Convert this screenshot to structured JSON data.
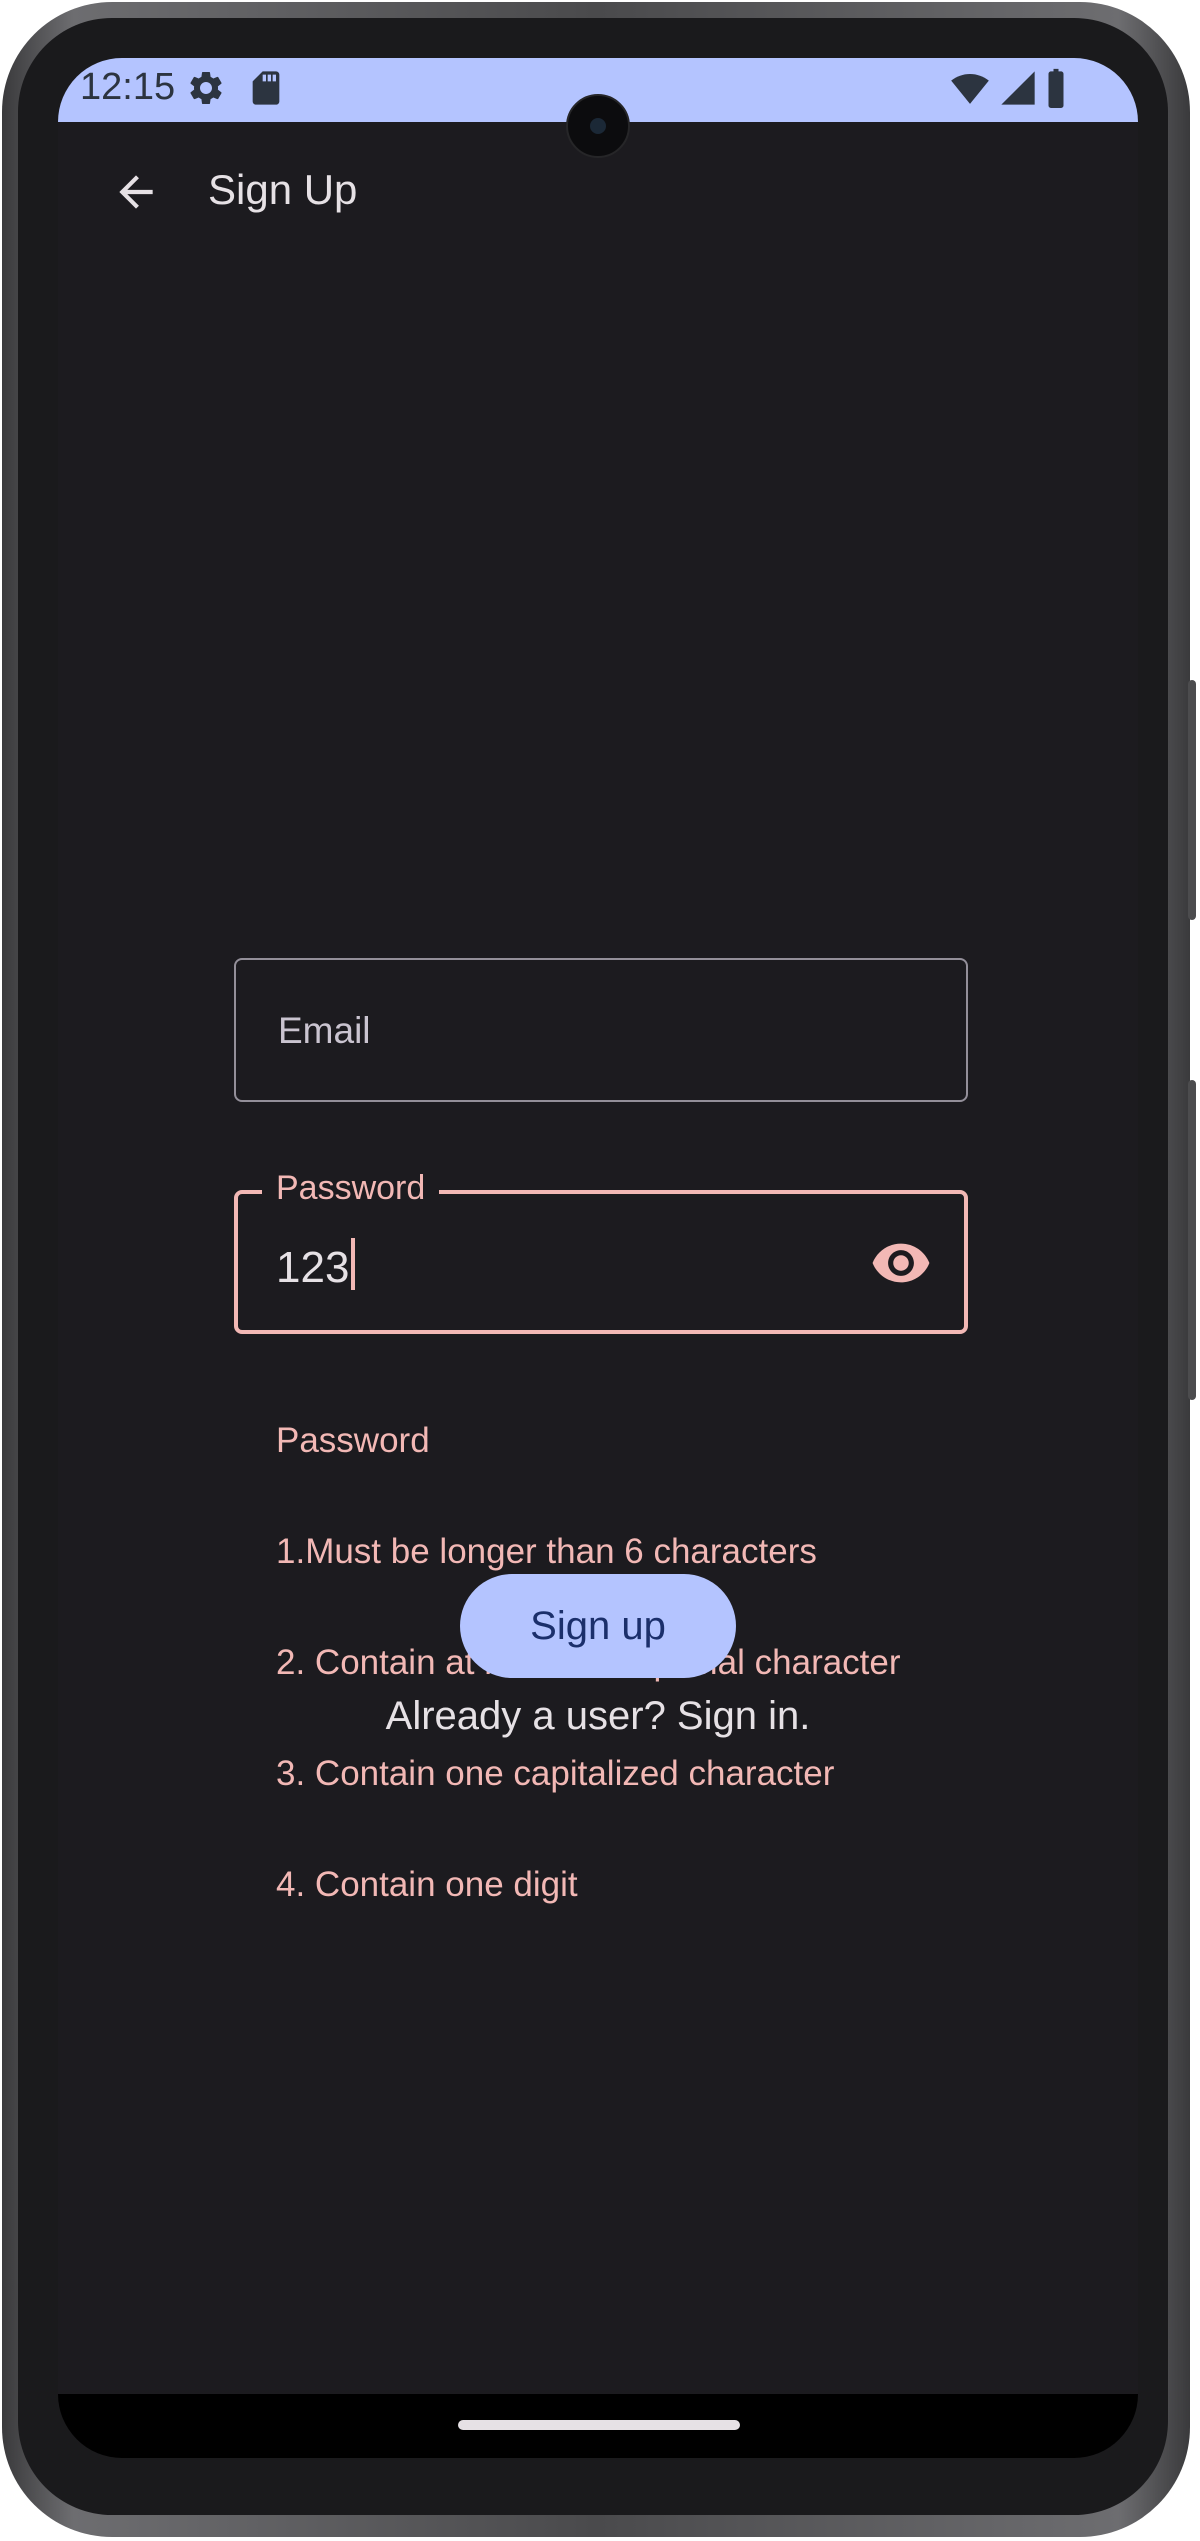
{
  "status_bar": {
    "time": "12:15",
    "left_icons": [
      "gear-icon",
      "sd-card-icon"
    ],
    "right_icons": [
      "wifi-icon",
      "cell-signal-icon",
      "battery-icon"
    ],
    "background": "#b4c4ff"
  },
  "app_bar": {
    "title": "Sign Up",
    "back_icon": "arrow-back-icon"
  },
  "form": {
    "email": {
      "placeholder": "Email",
      "value": ""
    },
    "password": {
      "label": "Password",
      "value": "123",
      "visibility_icon": "eye-icon",
      "error_color": "#f2b8b5",
      "supporting_text": [
        "Password",
        "1.Must be longer than 6 characters",
        "2. Contain at least one special character",
        "3. Contain one capitalized character",
        "4. Contain one digit"
      ]
    },
    "submit_label": "Sign up",
    "signin_link": "Already a user? Sign in."
  },
  "colors": {
    "background": "#1c1b1f",
    "primary": "#b4c4ff",
    "error": "#f2b8b5",
    "on_surface": "#e6e1e5"
  }
}
